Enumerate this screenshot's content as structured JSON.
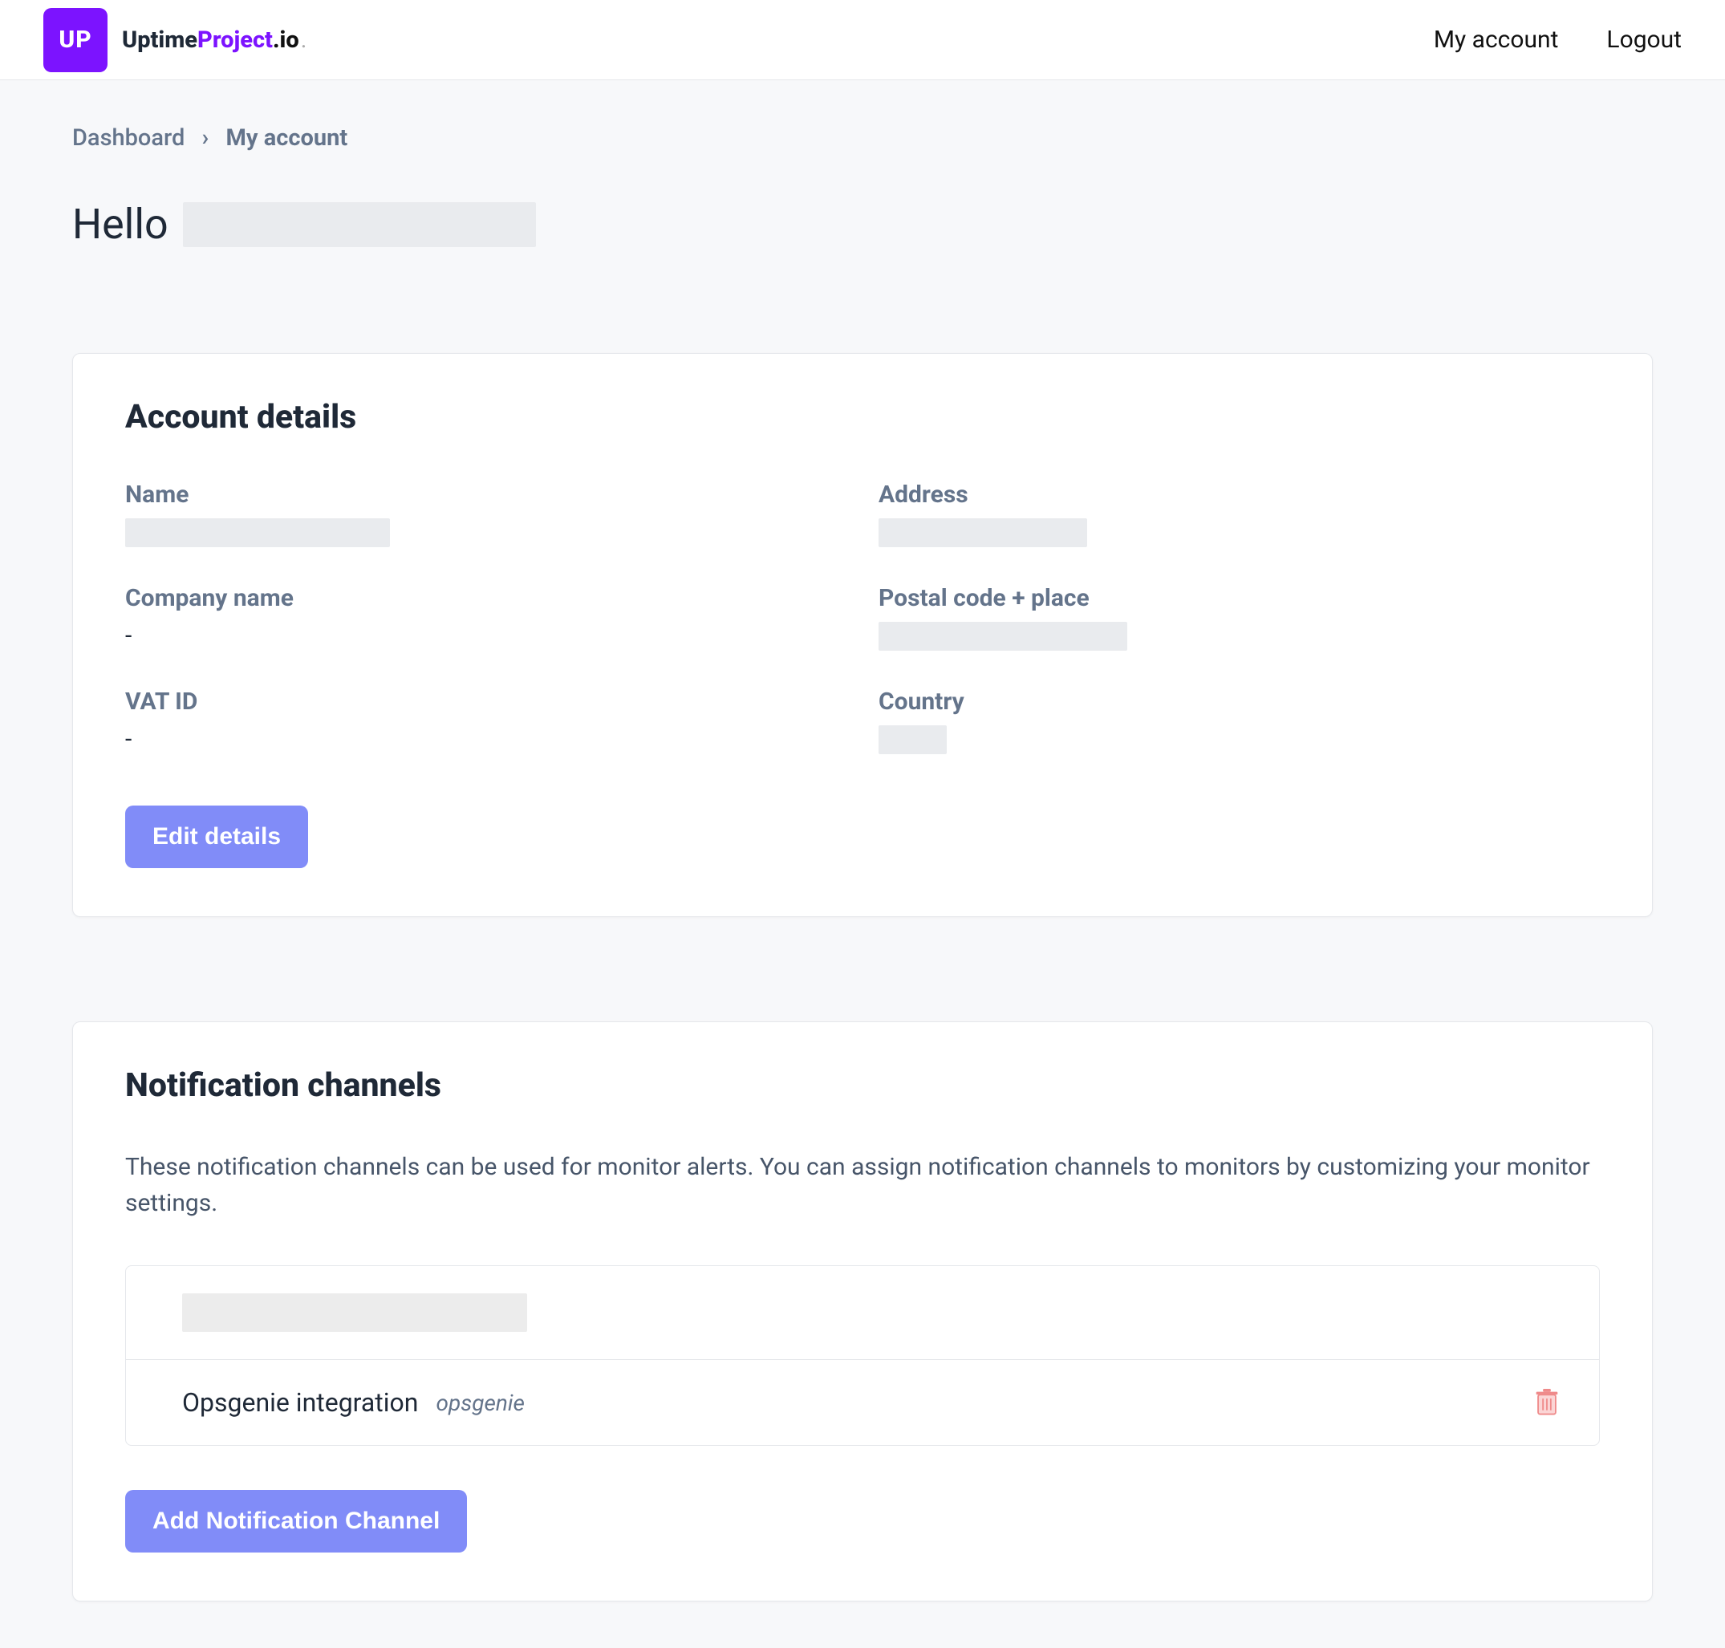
{
  "header": {
    "logo_badge": "UP",
    "logo_part1": "Uptime",
    "logo_part2": "Project",
    "logo_part3": ".io",
    "nav": {
      "my_account": "My account",
      "logout": "Logout"
    }
  },
  "breadcrumb": {
    "dashboard": "Dashboard",
    "sep": "›",
    "current": "My account"
  },
  "hello": {
    "greeting": "Hello"
  },
  "account": {
    "title": "Account details",
    "labels": {
      "name": "Name",
      "company": "Company name",
      "vat": "VAT ID",
      "address": "Address",
      "postal": "Postal code + place",
      "country": "Country"
    },
    "values": {
      "company": "-",
      "vat": "-"
    },
    "edit_btn": "Edit details"
  },
  "notifications": {
    "title": "Notification channels",
    "description": "These notification channels can be used for monitor alerts. You can assign notification channels to monitors by customizing your monitor settings.",
    "channels": [
      {
        "name": "",
        "type": "",
        "redacted": true
      },
      {
        "name": "Opsgenie integration",
        "type": "opsgenie",
        "redacted": false
      }
    ],
    "add_btn": "Add Notification Channel"
  },
  "icons": {
    "trash_color": "#ef8a8a"
  }
}
